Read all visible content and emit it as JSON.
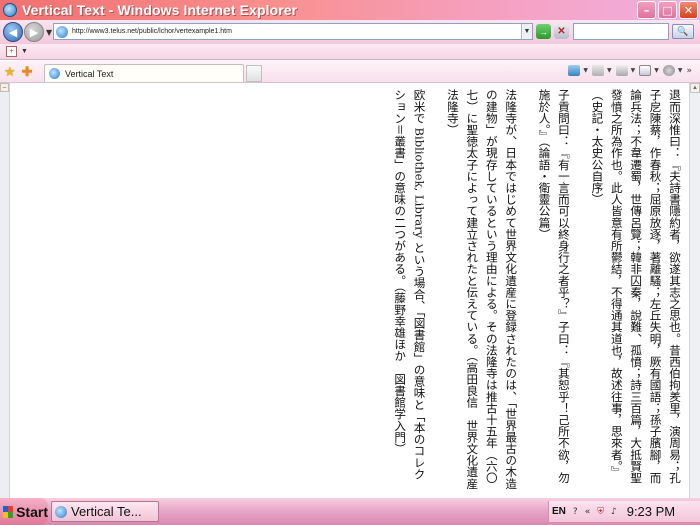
{
  "window": {
    "title": "Vertical Text - Windows Internet Explorer",
    "buttons": {
      "minimize": "–",
      "maximize": "□",
      "close": "✕"
    }
  },
  "address_bar": {
    "url": "http://www3.telus.net/public/lchor/vertexample1.htm",
    "back_glyph": "◀",
    "forward_glyph": "▶",
    "go_glyph": "→",
    "stop_glyph": "✕",
    "search_glyph": "🔍"
  },
  "tab": {
    "label": "Vertical Text"
  },
  "command_bar": {
    "home_icon": "home-icon",
    "feeds_icon": "feeds-icon",
    "print_icon": "print-icon",
    "page_label": "",
    "tools_icon": "gear-icon",
    "overflow": "»"
  },
  "content": {
    "paragraphs": [
      "退而深惟曰：『夫詩書隱約者，欲遂其志之思也。昔西伯拘羑里，演周易；孔子戹陳蔡，作春秋；屈原放逐，著離騷；左丘失明，厥有國語；孫子臏腳，而論兵法；不韋遷蜀，世傳呂覽；韓非囚秦，說難、孤憤；詩三百篇，大抵賢聖發憤之所為作也。此人皆意有所鬱結，不得通其道也，故述往事，思來者。』（史記・太史公自序）",
      "子貢問曰：『有一言而可以終身行之者乎？』子曰：『其恕乎！己所不欲，勿施於人。』（論語・衛靈公篇）",
      "法隆寺が、日本ではじめて世界文化遺産に登録されたのは、「世界最古の木造の建物」が現存しているという理由による。その法隆寺は推古十五年（六〇七）に聖徳太子によって建立されたと伝えている。（高田良信　世界文化遺産法隆寺）",
      "欧米で Bibliothek, Library という場合、「図書館」の意味と「本のコレクション＝叢書」の意味の二つがある。（藤野幸雄ほか　図書館学入門）"
    ]
  },
  "taskbar": {
    "start_label": "Start",
    "task_label": "Vertical Te...",
    "lang": "EN",
    "help_glyph": "?",
    "overflow": "«",
    "time": "9:23 PM"
  }
}
